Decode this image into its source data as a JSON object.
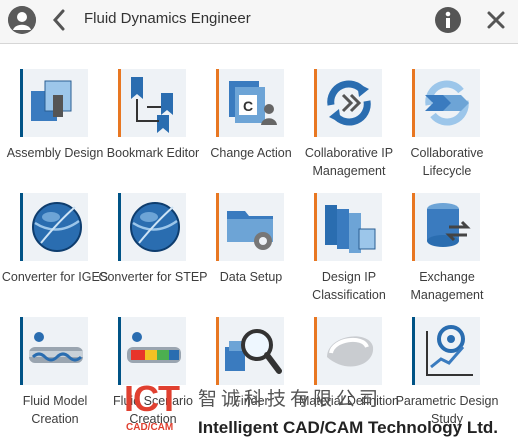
{
  "header": {
    "title": "Fluid Dynamics Engineer",
    "icons": [
      "avatar-icon",
      "back-chevron-icon",
      "info-icon",
      "close-icon"
    ]
  },
  "apps": [
    {
      "label": "Assembly Design",
      "icon": "assembly-design-icon",
      "accent": "blue"
    },
    {
      "label": "Bookmark Editor",
      "icon": "bookmark-editor-icon",
      "accent": "orange"
    },
    {
      "label": "Change Action",
      "icon": "change-action-icon",
      "accent": "orange"
    },
    {
      "label": "Collaborative IP Management",
      "icon": "collaborative-ip-icon",
      "accent": "orange"
    },
    {
      "label": "Collaborative Lifecycle",
      "icon": "collaborative-lifecycle-icon",
      "accent": "orange"
    },
    {
      "label": "Converter for IGES",
      "icon": "globe-icon",
      "accent": "blue"
    },
    {
      "label": "Converter for STEP",
      "icon": "globe-icon",
      "accent": "blue"
    },
    {
      "label": "Data Setup",
      "icon": "folder-gear-icon",
      "accent": "orange"
    },
    {
      "label": "Design IP Classification",
      "icon": "classification-icon",
      "accent": "orange"
    },
    {
      "label": "Exchange Management",
      "icon": "database-exchange-icon",
      "accent": "orange"
    },
    {
      "label": "Fluid Model Creation",
      "icon": "fluid-pipe-icon",
      "accent": "blue"
    },
    {
      "label": "Fluid Scenario Creation",
      "icon": "fluid-scenario-icon",
      "accent": "blue"
    },
    {
      "label": "Finder",
      "icon": "magnifier-icon",
      "accent": "orange"
    },
    {
      "label": "Material Definition",
      "icon": "material-sphere-icon",
      "accent": "orange"
    },
    {
      "label": "Parametric Design Study",
      "icon": "parametric-study-icon",
      "accent": "blue"
    }
  ],
  "watermark": {
    "logo": "ICT",
    "logo_sub": "CAD/CAM",
    "chinese": "智诚科技有限公司",
    "english": "Intelligent CAD/CAM Technology Ltd."
  },
  "colors": {
    "accent_blue": "#005386",
    "accent_orange": "#e87722",
    "header_bg": "#f6f6f6",
    "watermark_red": "#e04030"
  }
}
